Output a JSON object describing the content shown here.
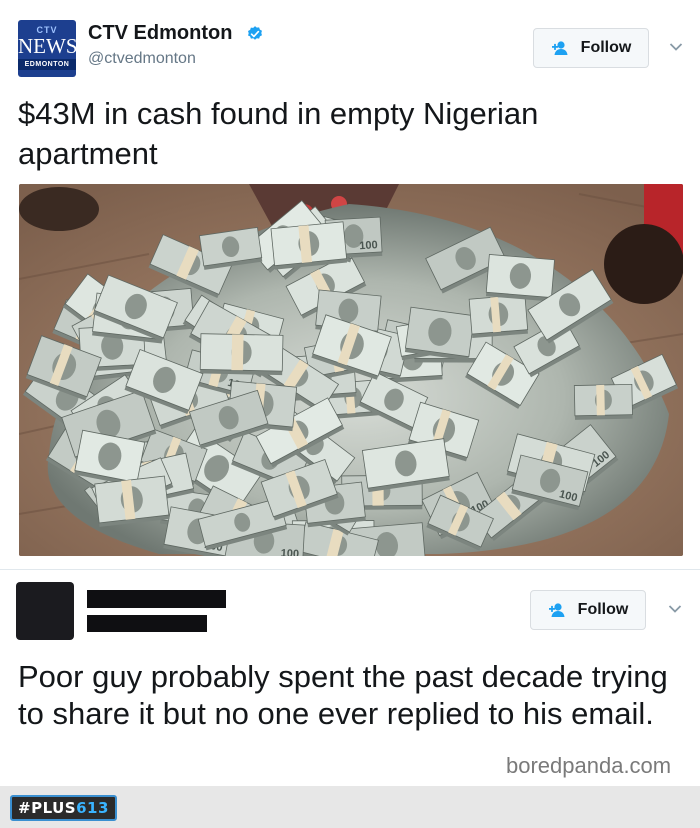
{
  "tweet1": {
    "avatar": {
      "top": "CTV",
      "middle": "NEWS",
      "bottom": "EDMONTON"
    },
    "display_name": "CTV Edmonton",
    "verified": true,
    "handle": "@ctvedmonton",
    "follow_label": "Follow",
    "text": "$43M in cash found in empty Nigerian apartment",
    "photo": {
      "visible_bill_labels": [
        "100",
        "100",
        "100",
        "100",
        "100",
        "100",
        "100",
        "100",
        "100",
        "100"
      ]
    }
  },
  "tweet2": {
    "follow_label": "Follow",
    "text": "Poor guy probably spent the past decade trying to share it but no one ever replied to his email."
  },
  "watermark": "boredpanda.com",
  "footer": {
    "logo_hash": "#",
    "logo_text": "PLUS",
    "logo_num": "613"
  },
  "colors": {
    "verified": "#1da1f2",
    "follow_icon": "#1da1f2",
    "border": "#e1e8ed"
  }
}
